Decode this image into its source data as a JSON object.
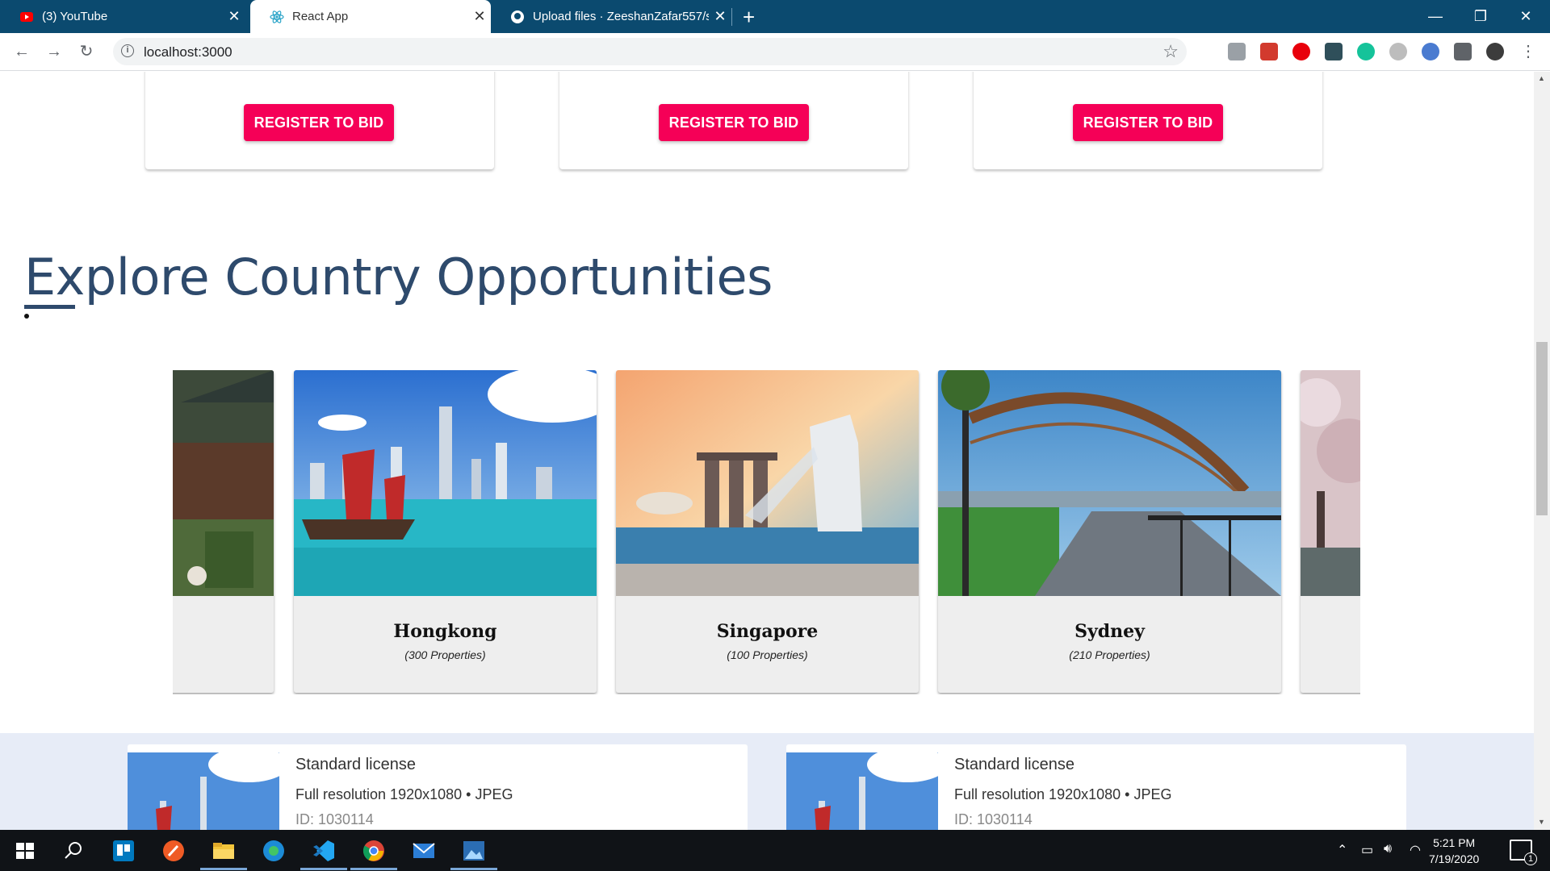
{
  "browser": {
    "tabs": [
      {
        "title": "(3) YouTube",
        "icon": "youtube-icon"
      },
      {
        "title": "React App",
        "icon": "react-icon"
      },
      {
        "title": "Upload files · ZeeshanZafar557/s",
        "icon": "github-icon"
      }
    ],
    "url": "localhost:3000"
  },
  "auction_cards": {
    "button_labels": [
      "REGISTER TO BID",
      "REGISTER TO BID",
      "REGISTER TO BID"
    ]
  },
  "section": {
    "title": "Explore Country Opportunities"
  },
  "countries": [
    {
      "name": "Hongkong",
      "properties": "(300 Properties)"
    },
    {
      "name": "Singapore",
      "properties": "(100 Properties)"
    },
    {
      "name": "Sydney",
      "properties": "(210 Properties)"
    }
  ],
  "licenses": [
    {
      "title": "Standard license",
      "resolution": "Full resolution 1920x1080 • JPEG",
      "id": "ID: 1030114"
    },
    {
      "title": "Standard license",
      "resolution": "Full resolution 1920x1080 • JPEG",
      "id": "ID: 1030114"
    }
  ],
  "taskbar": {
    "time": "5:21 PM",
    "date": "7/19/2020",
    "notifications": "1"
  },
  "colors": {
    "accent": "#f50057",
    "title": "#2e4a6c",
    "tabstrip": "#0b4a6f"
  }
}
